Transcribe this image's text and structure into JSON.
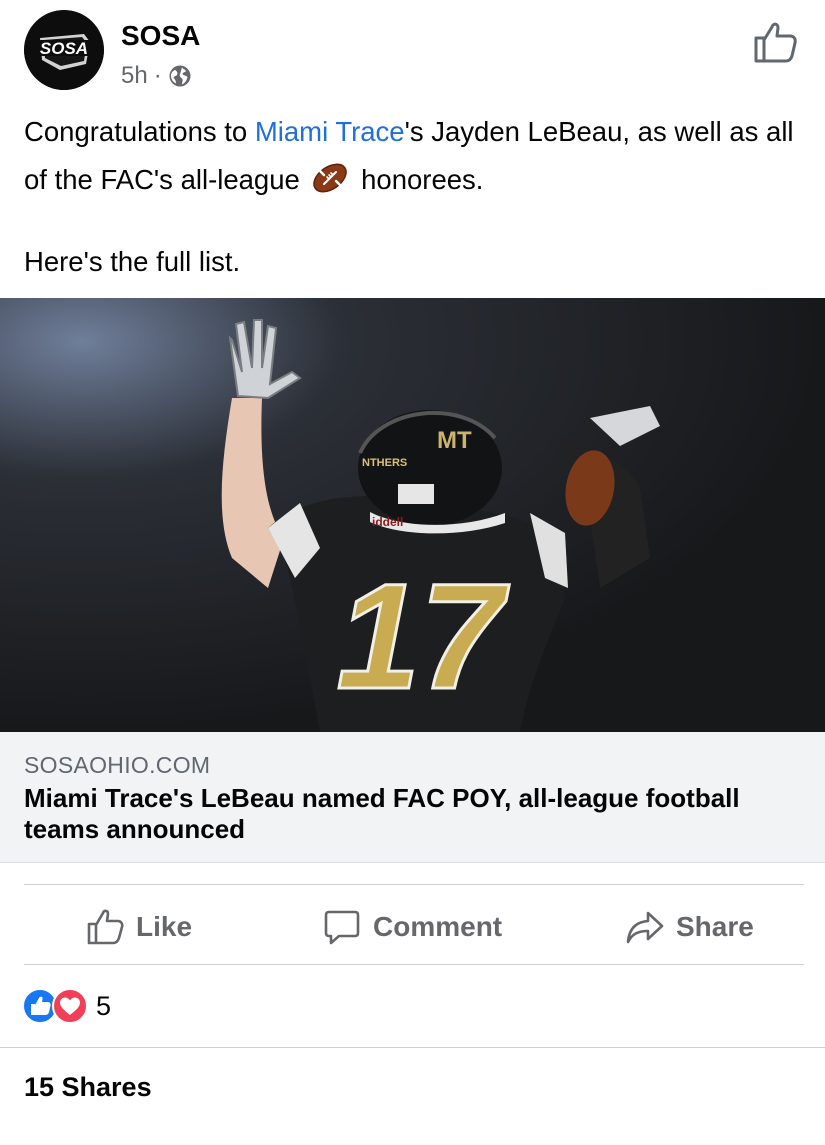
{
  "post": {
    "author": "SOSA",
    "avatar_text": "SOSA",
    "timestamp": "5h",
    "separator": "·",
    "audience_icon": "globe-icon",
    "text_part1": "Congratulations to ",
    "mention": "Miami Trace",
    "text_part2": "'s Jayden LeBeau, as well as all of the FAC's all-league ",
    "emoji": "football-emoji",
    "text_part3": " honorees.",
    "text_line2": "Here's the full list."
  },
  "photo": {
    "jersey_number": "17",
    "helmet_text": "NTHERS",
    "helmet_logo": "MT",
    "brand_text": "iddell"
  },
  "link_preview": {
    "domain": "SOSAOHIO.COM",
    "title": "Miami Trace's LeBeau named FAC POY, all-league football teams announced"
  },
  "actions": {
    "like": "Like",
    "comment": "Comment",
    "share": "Share"
  },
  "reactions": {
    "icons": [
      "like-reaction-icon",
      "love-reaction-icon"
    ],
    "count": "5"
  },
  "shares": "15 Shares",
  "colors": {
    "link": "#216fdb",
    "secondary_text": "#65676b",
    "like_blue": "#1877f2",
    "love_red": "#f33e58"
  }
}
